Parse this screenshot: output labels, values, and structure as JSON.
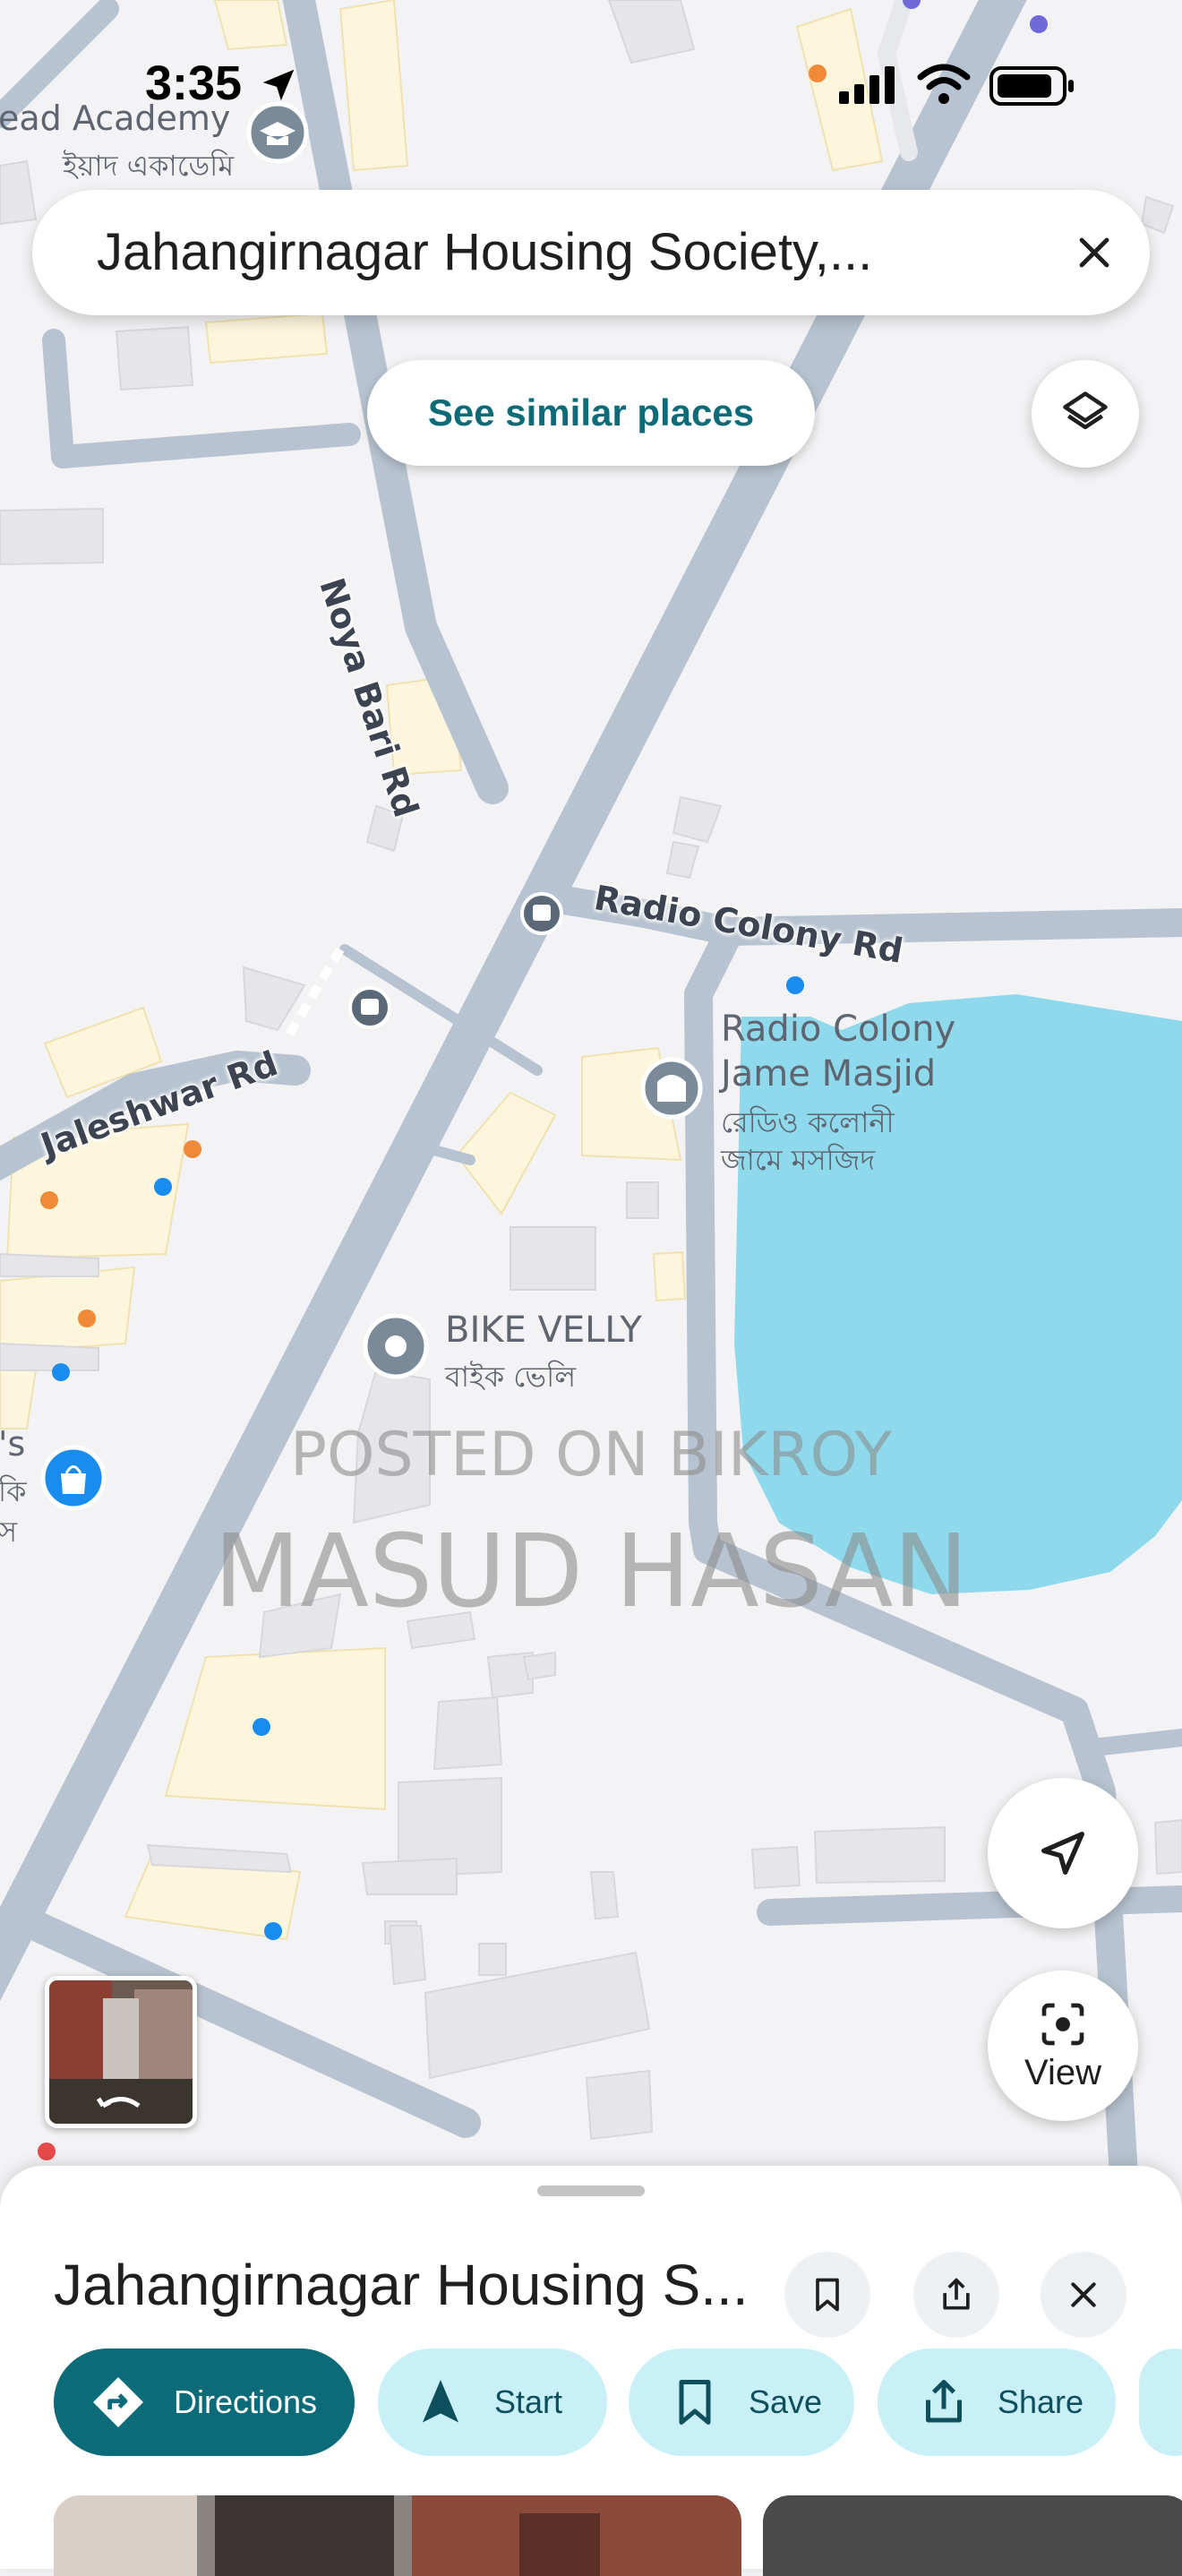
{
  "status_bar": {
    "time": "3:35"
  },
  "search": {
    "query": "Jahangirnagar Housing Society,..."
  },
  "chips": {
    "similar_places": "See similar places"
  },
  "map": {
    "roads": [
      "Noya Bari Rd",
      "Radio Colony Rd",
      "Jaleshwar Rd"
    ],
    "places": {
      "academy_en": "ead Academy",
      "academy_bn": "ইয়াদ একাডেমি",
      "masjid_line1": "Radio Colony",
      "masjid_line2": "Jame Masjid",
      "masjid_bn1": "রেডিও কলোনী",
      "masjid_bn2": "জামে মসজিদ",
      "bike_en": "BIKE VELLY",
      "bike_bn": "বাইক ভেলি",
      "left_edge_1": "'s",
      "left_edge_2": "কি",
      "left_edge_3": "স"
    },
    "colors": {
      "water": "#8fd9ec",
      "road": "#b7c3d0",
      "building": "#fdf6dc",
      "accent": "#0b6b78"
    }
  },
  "watermark": {
    "line1": "POSTED ON BIKROY",
    "line2": "MASUD HASAN"
  },
  "controls": {
    "view_label": "View"
  },
  "sheet": {
    "title": "Jahangirnagar Housing S...",
    "actions": [
      {
        "label": "Directions",
        "icon": "directions-icon"
      },
      {
        "label": "Start",
        "icon": "navigation-arrow-icon"
      },
      {
        "label": "Save",
        "icon": "bookmark-icon"
      },
      {
        "label": "Share",
        "icon": "share-icon"
      }
    ]
  }
}
